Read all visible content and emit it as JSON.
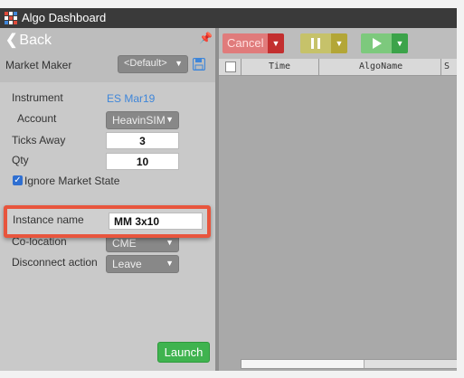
{
  "window": {
    "title": "Algo Dashboard"
  },
  "left_panel": {
    "back_label": "Back",
    "market_maker": {
      "label": "Market Maker",
      "value": "<Default>"
    },
    "instrument": {
      "label": "Instrument",
      "value": "ES Mar19"
    },
    "account": {
      "label": "Account",
      "value": "HeavinSIM"
    },
    "ticks_away": {
      "label": "Ticks Away",
      "value": "3"
    },
    "qty": {
      "label": "Qty",
      "value": "10"
    },
    "ignore_market_state": {
      "label": "Ignore Market State",
      "checked": true
    },
    "instance_name": {
      "label": "Instance name",
      "value": "MM 3x10"
    },
    "co_location": {
      "label": "Co-location",
      "value": "CME"
    },
    "disconnect_action": {
      "label": "Disconnect action",
      "value": "Leave"
    },
    "launch_label": "Launch"
  },
  "toolbar": {
    "cancel_label": "Cancel"
  },
  "grid": {
    "columns": [
      "Time",
      "AlgoName",
      "S"
    ],
    "rows": []
  },
  "colors": {
    "highlight_border": "#e8553d",
    "launch_green": "#3fb34f",
    "cancel_red": "#c32f2f",
    "link_blue": "#3f86d9"
  }
}
